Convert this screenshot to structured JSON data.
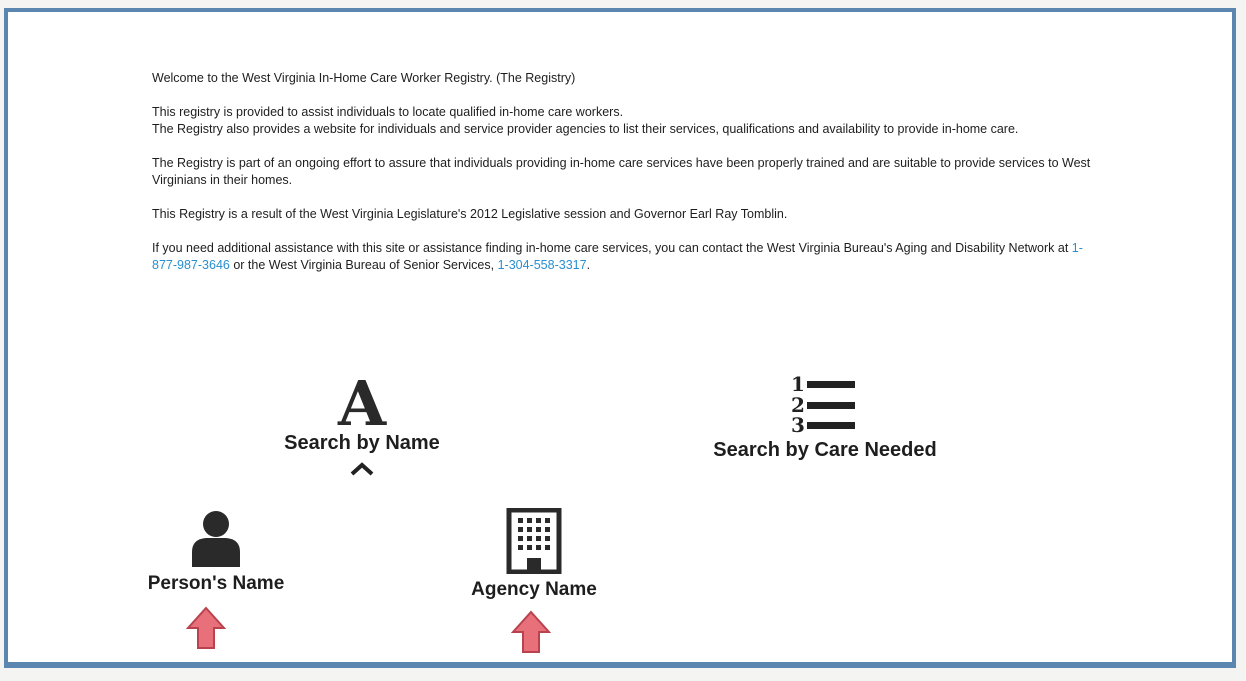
{
  "intro": {
    "welcome": "Welcome to the West Virginia In-Home Care Worker Registry. (The Registry)",
    "p1_line1": "This registry is provided to assist individuals to locate qualified in-home care workers.",
    "p1_line2": "The Registry also provides a website for individuals and service provider agencies to list their services, qualifications and availability to provide in-home care.",
    "p2": "The Registry is part of an ongoing effort to assure that individuals providing in-home care services have been properly trained and are suitable to provide services to West Virginians in their homes.",
    "p3": "This Registry is a result of the West Virginia Legislature's 2012 Legislative session and Governor Earl Ray Tomblin.",
    "p4_before": "If you need additional assistance with this site or assistance finding in-home care services, you can contact the West Virginia Bureau's Aging and Disability Network at ",
    "phone_adrn": "1-877-987-3646",
    "p4_middle": " or the West Virginia Bureau of Senior Services, ",
    "phone_bss": "1-304-558-3317",
    "p4_after": "."
  },
  "search_by_name": {
    "icon_letter": "A",
    "label": "Search by Name",
    "icon": "letter-a-icon",
    "caret_icon": "chevron-up-icon"
  },
  "search_by_care": {
    "label": "Search by Care Needed",
    "icon": "numbered-list-icon",
    "numbers": [
      "1",
      "2",
      "3"
    ]
  },
  "person_name": {
    "label": "Person's Name",
    "icon": "person-icon"
  },
  "agency_name": {
    "label": "Agency Name",
    "icon": "building-icon"
  },
  "annotation": {
    "arrow_color": "#e8707a",
    "arrow_outline": "#b8434e"
  },
  "colors": {
    "frame_border": "#5a86b0",
    "link": "#2a8fd0"
  }
}
